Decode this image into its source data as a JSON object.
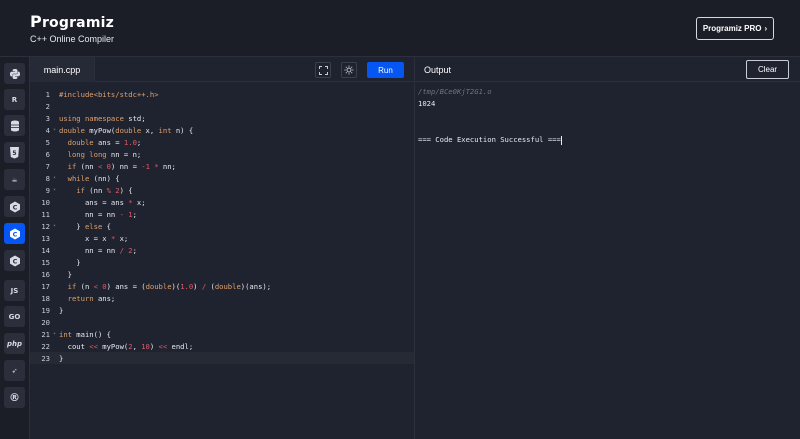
{
  "header": {
    "logo_text": "rogramiz",
    "logo_mark": "P",
    "subtitle": "C++ Online Compiler",
    "pro_label": "Programiz PRO",
    "pro_chevron": "›"
  },
  "sidebar": {
    "langs": [
      {
        "name": "python",
        "glyph": "🐍"
      },
      {
        "name": "r",
        "glyph": "R"
      },
      {
        "name": "sql",
        "glyph": "≡"
      },
      {
        "name": "html",
        "glyph": "5"
      },
      {
        "name": "java",
        "glyph": "☕"
      },
      {
        "name": "c",
        "glyph": "C"
      },
      {
        "name": "cpp",
        "glyph": "C"
      },
      {
        "name": "csharp",
        "glyph": "C"
      },
      {
        "name": "js",
        "glyph": "JS"
      },
      {
        "name": "go",
        "glyph": "GO"
      },
      {
        "name": "php",
        "glyph": "php"
      },
      {
        "name": "swift",
        "glyph": "➶"
      },
      {
        "name": "rust",
        "glyph": "®"
      }
    ]
  },
  "editor": {
    "tab_label": "main.cpp",
    "run_label": "Run",
    "lines": [
      "#include<bits/stdc++.h>",
      "",
      "using namespace std;",
      "double myPow(double x, int n) {",
      "  double ans = 1.0;",
      "  long long nn = n;",
      "  if (nn < 0) nn = -1 * nn;",
      "  while (nn) {",
      "    if (nn % 2) {",
      "      ans = ans * x;",
      "      nn = nn - 1;",
      "    } else {",
      "      x = x * x;",
      "      nn = nn / 2;",
      "    }",
      "  }",
      "  if (n < 0) ans = (double)(1.0) / (double)(ans);",
      "  return ans;",
      "}",
      "",
      "int main() {",
      "  cout << myPow(2, 10) << endl;",
      "}"
    ]
  },
  "output": {
    "title": "Output",
    "clear_label": "Clear",
    "path": "/tmp/BCe0KjT2G1.o",
    "result": "1024",
    "success": "=== Code Execution Successful ==="
  },
  "colors": {
    "accent": "#0556f3",
    "background": "#1f2330",
    "keyword": "#e0a06b",
    "number": "#e05b63"
  }
}
